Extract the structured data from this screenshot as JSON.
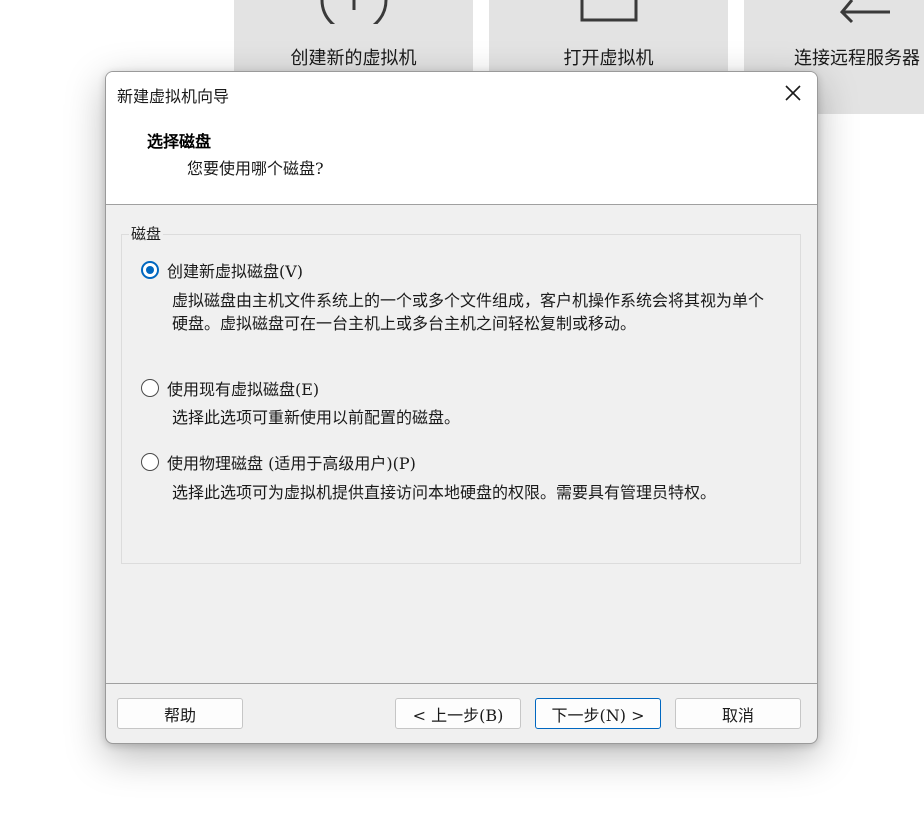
{
  "home": {
    "tiles": [
      {
        "label": "创建新的虚拟机",
        "icon": "plus-circle-icon"
      },
      {
        "label": "打开虚拟机",
        "icon": "open-file-icon"
      },
      {
        "label": "连接远程服务器",
        "icon": "arrow-left-icon"
      }
    ]
  },
  "dialog": {
    "title": "新建虚拟机向导",
    "close_icon": "close-icon",
    "header": {
      "title": "选择磁盘",
      "subtitle": "您要使用哪个磁盘?"
    },
    "group_label": "磁盘",
    "options": [
      {
        "label": "创建新虚拟磁盘(V)",
        "checked": true,
        "description": "虚拟磁盘由主机文件系统上的一个或多个文件组成，客户机操作系统会将其视为单个硬盘。虚拟磁盘可在一台主机上或多台主机之间轻松复制或移动。"
      },
      {
        "label": "使用现有虚拟磁盘(E)",
        "checked": false,
        "description": "选择此选项可重新使用以前配置的磁盘。"
      },
      {
        "label": "使用物理磁盘 (适用于高级用户)(P)",
        "checked": false,
        "description": "选择此选项可为虚拟机提供直接访问本地硬盘的权限。需要具有管理员特权。"
      }
    ],
    "buttons": {
      "help": "帮助",
      "back": "< 上一步(B)",
      "next": "下一步(N) >",
      "cancel": "取消"
    },
    "colors": {
      "accent": "#0067c0",
      "dialog_bg": "#f0f0f0",
      "header_bg": "#ffffff",
      "tile_bg": "#e3e3e3"
    }
  }
}
